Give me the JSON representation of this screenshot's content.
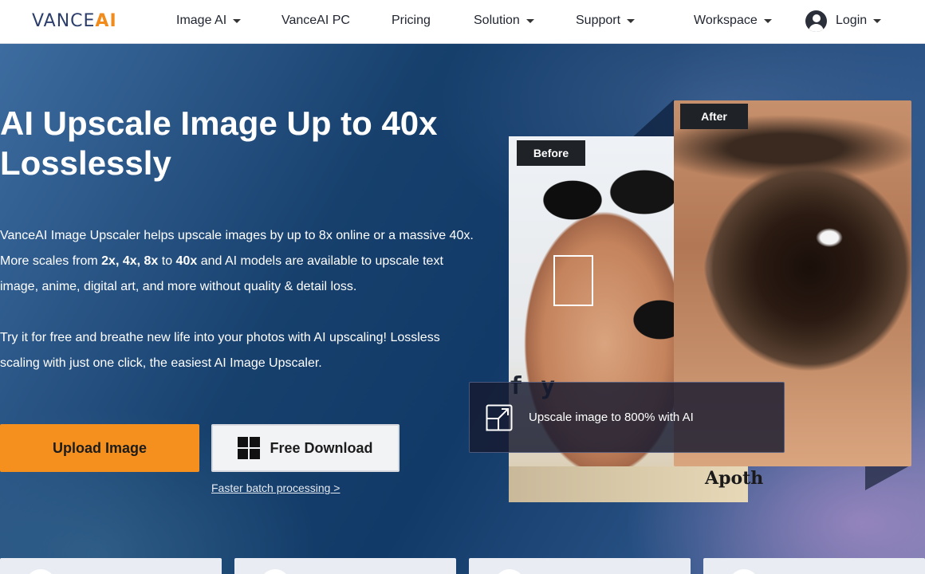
{
  "nav": {
    "logo_main": "VANCE",
    "logo_ai": "AI",
    "items": [
      {
        "label": "Image AI",
        "dropdown": true
      },
      {
        "label": "VanceAI PC",
        "dropdown": false
      },
      {
        "label": "Pricing",
        "dropdown": false
      },
      {
        "label": "Solution",
        "dropdown": true
      },
      {
        "label": "Support",
        "dropdown": true
      },
      {
        "label": "Workspace",
        "dropdown": true
      }
    ],
    "login_label": "Login"
  },
  "hero": {
    "headline": "AI Upscale Image Up to 40x Losslessly",
    "para1": {
      "t1": "VanceAI Image Upscaler helps upscale images by up to 8x online or a massive 40x. More scales from ",
      "b1": "2x, 4x, 8x",
      "t2": " to ",
      "b2": "40x",
      "t3": " and AI models are available to upscale text image, anime, digital art, and more without quality & detail loss."
    },
    "para2": "Try it for free and breathe new life into your photos with AI upscaling! Lossless scaling with just one click, the easiest AI Image Upscaler.",
    "upload_label": "Upload Image",
    "download_label": "Free Download",
    "batch_link": "Faster batch processing >"
  },
  "visual": {
    "before_label": "Before",
    "after_label": "After",
    "caption": "Upscale image to 800% with AI",
    "fy_text": "f y",
    "apoth_text": "Apoth"
  },
  "colors": {
    "accent": "#f5901e",
    "nav_bg": "#ffffff",
    "hero_dark": "#123a68"
  },
  "icons": [
    "caret-down-icon",
    "user-avatar-icon",
    "windows-logo-icon",
    "expand-icon"
  ]
}
